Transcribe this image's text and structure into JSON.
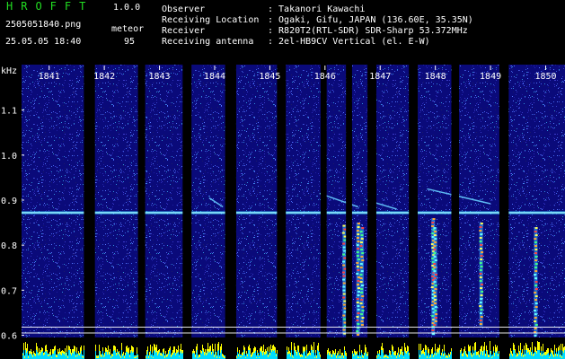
{
  "header": {
    "app_name": "HROFFT",
    "version": "1.0.0",
    "file_name": "2505051840.png",
    "date_time": "25.05.05 18:40",
    "meteor_label": "meteor",
    "meteor_count": "95"
  },
  "info": [
    {
      "label": "Observer",
      "value": ": Takanori Kawachi"
    },
    {
      "label": "Receiving Location",
      "value": ": Ogaki, Gifu, JAPAN (136.60E, 35.35N)"
    },
    {
      "label": "Receiver",
      "value": ": R820T2(RTL-SDR) SDR-Sharp 53.372MHz"
    },
    {
      "label": "Receiving antenna",
      "value": ": 2el-HB9CV Vertical (el. E-W)"
    }
  ],
  "colors": {
    "title_green": "#22dd22",
    "background": "#000000",
    "spectrogram_base": "#0a0a7a",
    "beacon_line": "#33ccff",
    "amplitude_yellow": "#ffff00",
    "amplitude_cyan": "#00ddff"
  },
  "chart_data": {
    "type": "heatmap",
    "ylabel": "kHz",
    "y_ticks": [
      "1.1",
      "1.0",
      "0.9",
      "0.8",
      "0.7",
      "0.6"
    ],
    "y_tick_values": [
      1.1,
      1.0,
      0.9,
      0.8,
      0.7,
      0.6
    ],
    "ylim": [
      0.595,
      1.165
    ],
    "x_ticks": [
      "1841",
      "1842",
      "1843",
      "1844",
      "1845",
      "1846",
      "1847",
      "1848",
      "1849",
      "1850"
    ],
    "xlim": [
      1840.5,
      1850.35
    ],
    "beacon_khz": 0.872,
    "reference_lines_khz": [
      0.618,
      0.605
    ],
    "gaps_minutes": [
      [
        1841.63,
        1841.83
      ],
      [
        1842.61,
        1842.74
      ],
      [
        1843.42,
        1843.58
      ],
      [
        1844.19,
        1844.39
      ],
      [
        1845.13,
        1845.29
      ],
      [
        1845.92,
        1846.03
      ],
      [
        1846.38,
        1846.49
      ],
      [
        1846.77,
        1846.93
      ],
      [
        1847.52,
        1847.68
      ],
      [
        1848.29,
        1848.43
      ],
      [
        1849.16,
        1849.33
      ]
    ],
    "meteor_echoes": [
      {
        "minute": 1846.35,
        "khz_top": 0.845,
        "khz_bottom": 0.6
      },
      {
        "minute": 1846.6,
        "khz_top": 0.85,
        "khz_bottom": 0.6
      },
      {
        "minute": 1846.67,
        "khz_top": 0.84,
        "khz_bottom": 0.62
      },
      {
        "minute": 1847.96,
        "khz_top": 0.86,
        "khz_bottom": 0.6
      },
      {
        "minute": 1848.0,
        "khz_top": 0.84,
        "khz_bottom": 0.62
      },
      {
        "minute": 1848.83,
        "khz_top": 0.85,
        "khz_bottom": 0.62
      },
      {
        "minute": 1849.82,
        "khz_top": 0.84,
        "khz_bottom": 0.6
      }
    ],
    "drifting_traces": [
      {
        "minute_start": 1843.9,
        "minute_end": 1844.15,
        "khz_start": 0.905,
        "khz_end": 0.885
      },
      {
        "minute_start": 1845.9,
        "minute_end": 1846.6,
        "khz_start": 0.915,
        "khz_end": 0.885
      },
      {
        "minute_start": 1846.75,
        "minute_end": 1847.3,
        "khz_start": 0.9,
        "khz_end": 0.88
      },
      {
        "minute_start": 1847.85,
        "minute_end": 1849.0,
        "khz_start": 0.925,
        "khz_end": 0.892
      }
    ]
  }
}
